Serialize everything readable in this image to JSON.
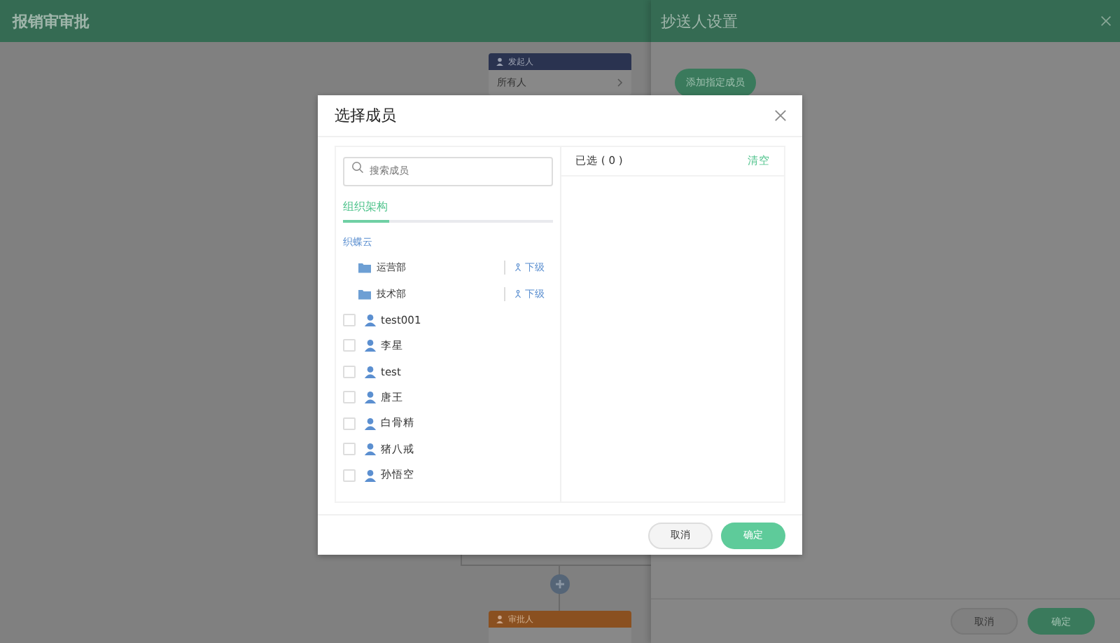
{
  "page": {
    "title": "报销审审批"
  },
  "flow": {
    "start_node": {
      "header": "发起人",
      "value": "所有人"
    },
    "approver_node": {
      "header": "审批人"
    }
  },
  "drawer": {
    "title": "抄送人设置",
    "add_button": "添加指定成员",
    "buttons": [
      {
        "label": "取消",
        "kind": "secondary"
      },
      {
        "label": "确定",
        "kind": "primary"
      }
    ]
  },
  "dialog": {
    "title": "选择成员",
    "search": {
      "placeholder": "搜索成员"
    },
    "tabs": [
      {
        "label": "组织架构",
        "selected": true
      }
    ],
    "org": "织蝶云",
    "departments": [
      {
        "name": "运营部",
        "action": "下级"
      },
      {
        "name": "技术部",
        "action": "下级"
      }
    ],
    "members": [
      {
        "name": "test001",
        "checked": false
      },
      {
        "name": "李星",
        "checked": false
      },
      {
        "name": "test",
        "checked": false
      },
      {
        "name": "唐王",
        "checked": false
      },
      {
        "name": "白骨精",
        "checked": false
      },
      {
        "name": "猪八戒",
        "checked": false
      },
      {
        "name": "孙悟空",
        "checked": false
      }
    ],
    "selected_header": "已选 ( 0 )",
    "clear": "清空",
    "buttons": [
      {
        "label": "取消",
        "kind": "secondary"
      },
      {
        "label": "确定",
        "kind": "primary"
      }
    ]
  }
}
